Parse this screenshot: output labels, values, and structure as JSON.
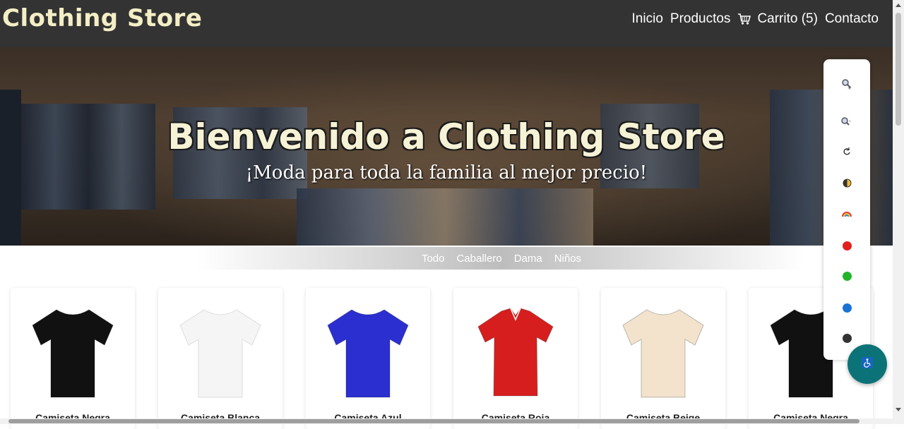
{
  "header": {
    "brand": "Clothing Store",
    "nav": {
      "home": "Inicio",
      "products": "Productos",
      "cart": "Carrito (5)",
      "contact": "Contacto"
    }
  },
  "hero": {
    "title": "Bienvenido a Clothing Store",
    "subtitle": "¡Moda para toda la familia al mejor precio!"
  },
  "filters": [
    "Todo",
    "Caballero",
    "Dama",
    "Niños"
  ],
  "products": [
    {
      "name": "Camiseta Negra",
      "color": "#111111",
      "type": "tshirt"
    },
    {
      "name": "Camiseta Blanca",
      "color": "#f5f5f5",
      "type": "tshirt"
    },
    {
      "name": "Camiseta Azul",
      "color": "#2b2fd0",
      "type": "tshirt"
    },
    {
      "name": "Camiseta Roja",
      "color": "#d71e1e",
      "type": "polo"
    },
    {
      "name": "Camiseta Beige",
      "color": "#f3e3cd",
      "type": "tshirt"
    },
    {
      "name": "Camiseta Negra",
      "color": "#111111",
      "type": "tshirt"
    }
  ],
  "accessibility": {
    "buttons": [
      {
        "icon": "zoom-in-icon",
        "glyph": "🔍+"
      },
      {
        "icon": "zoom-out-icon",
        "glyph": "🔍-"
      },
      {
        "icon": "reset-icon",
        "glyph": "↺"
      },
      {
        "icon": "contrast-icon",
        "glyph": "◐"
      },
      {
        "icon": "rainbow-icon",
        "glyph": "🌈"
      }
    ],
    "color_dots": [
      "#e0201c",
      "#22b52a",
      "#1a73d4",
      "#333333"
    ],
    "fab_icon": "wheelchair-icon"
  },
  "colors": {
    "navbar": "#333333",
    "brand": "#f3eec5",
    "accent": "#0b7377"
  }
}
